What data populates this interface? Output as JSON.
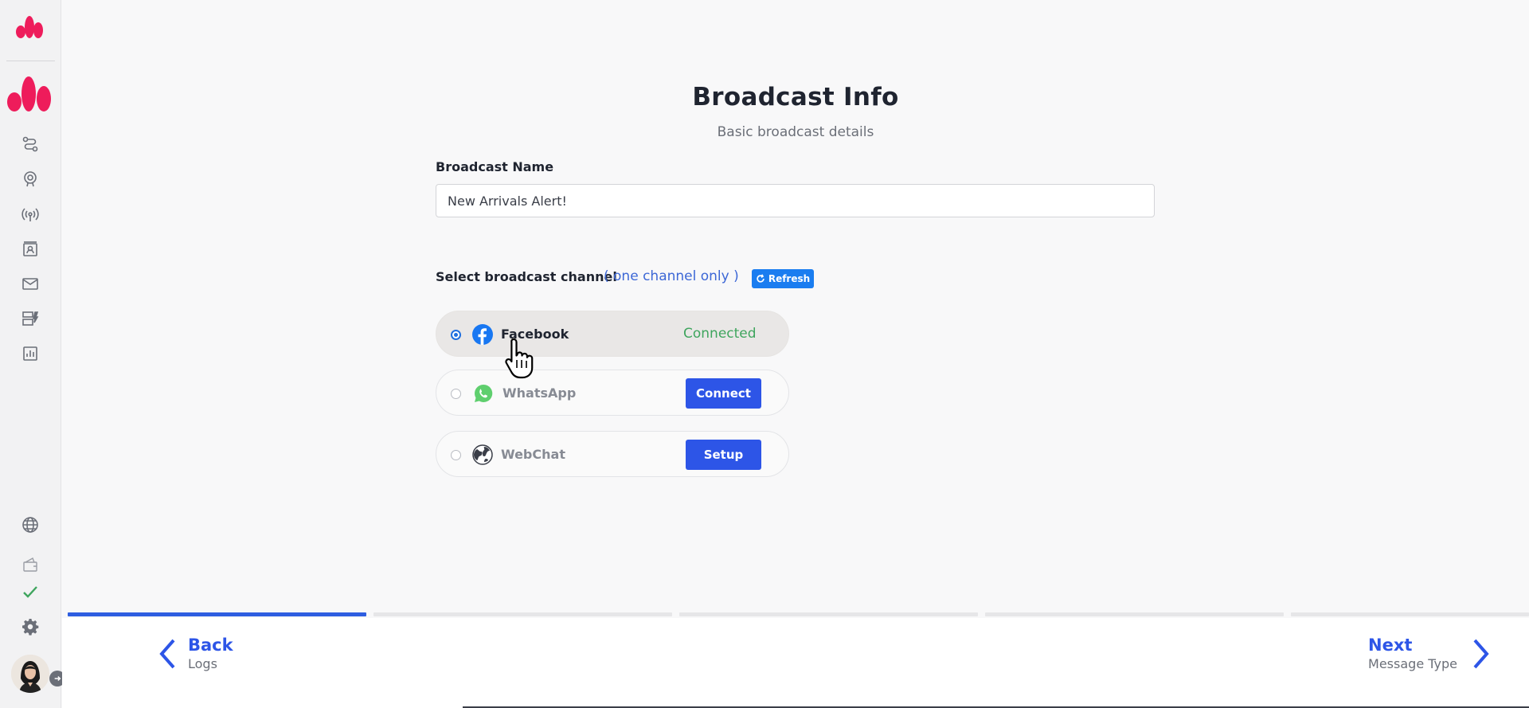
{
  "page": {
    "title": "Broadcast Info",
    "subtitle": "Basic broadcast details"
  },
  "form": {
    "name_label": "Broadcast Name",
    "name_value": "New Arrivals Alert!",
    "channel_label": "Select broadcast channel",
    "channel_hint": "( one channel only )",
    "refresh_label": "Refresh"
  },
  "channels": [
    {
      "name": "Facebook",
      "selected": true,
      "status": "Connected",
      "icon": "facebook-icon",
      "color": "#1877f2"
    },
    {
      "name": "WhatsApp",
      "selected": false,
      "action": "Connect",
      "icon": "whatsapp-icon",
      "color": "#4fce5d"
    },
    {
      "name": "WebChat",
      "selected": false,
      "action": "Setup",
      "icon": "globe-icon",
      "color": "#3a3e48"
    }
  ],
  "progress": {
    "total_steps": 5,
    "current_step": 1
  },
  "footer": {
    "back_label": "Back",
    "back_sub": "Logs",
    "next_label": "Next",
    "next_sub": "Message Type"
  },
  "sidebar": {
    "top_icons": [
      "flow-icon",
      "support-icon",
      "broadcast-icon",
      "contacts-icon",
      "mail-icon",
      "templates-icon",
      "analytics-icon"
    ],
    "bottom_icons": [
      "globe-icon",
      "wallet-icon",
      "check-icon",
      "gear-icon"
    ]
  },
  "colors": {
    "accent": "#2d55e7",
    "brand": "#ee1c5b",
    "connected": "#3fa55e",
    "refresh": "#1a7df0"
  }
}
